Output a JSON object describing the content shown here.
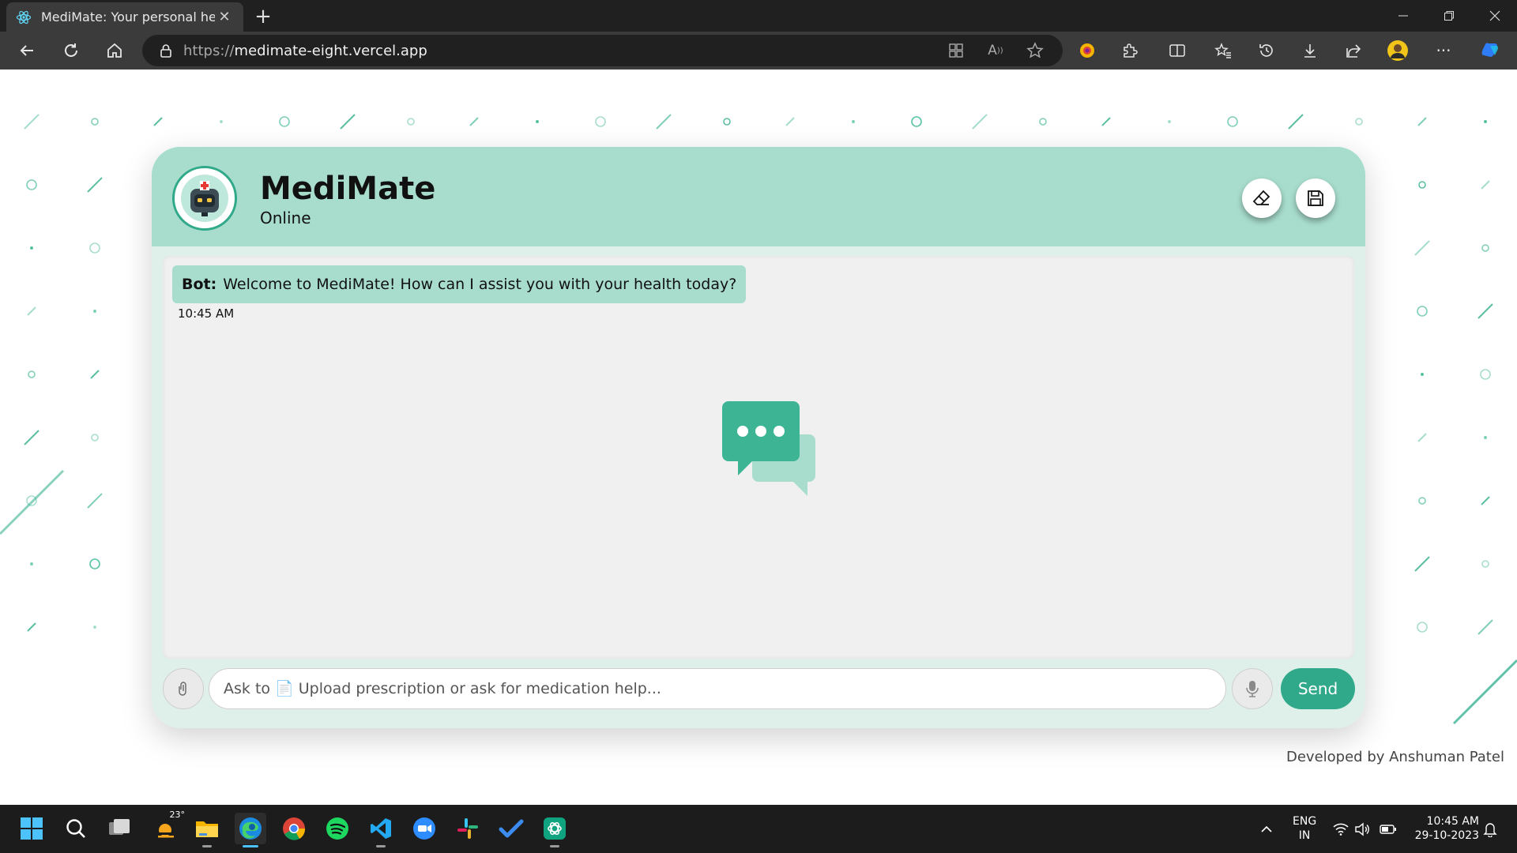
{
  "browser": {
    "tab_title": "MediMate: Your personal health",
    "url_protocol": "https://",
    "url_host": "medimate-eight.vercel.app"
  },
  "chat": {
    "bot_name": "MediMate",
    "status": "Online",
    "messages": [
      {
        "sender": "Bot:",
        "text": "Welcome to MediMate! How can I assist you with your health today?",
        "time": "10:45 AM"
      }
    ],
    "input_placeholder": "Ask to 📄 Upload prescription or ask for medication help...",
    "send_label": "Send",
    "icons": {
      "clear": "eraser-icon",
      "save": "floppy-disk-icon",
      "attach": "attach-icon",
      "mic": "microphone-icon",
      "empty_state": "chat-bubbles-icon"
    }
  },
  "footer": {
    "credit": "Developed by Anshuman Patel"
  },
  "taskbar": {
    "weather_temp": "23°",
    "lang_line1": "ENG",
    "lang_line2": "IN",
    "time": "10:45 AM",
    "date": "29-10-2023"
  },
  "colors": {
    "accent": "#2fa98a",
    "header_bg": "#a8ddcd",
    "card_bg": "#dff0ea",
    "chat_bg": "#f0f0f0"
  }
}
